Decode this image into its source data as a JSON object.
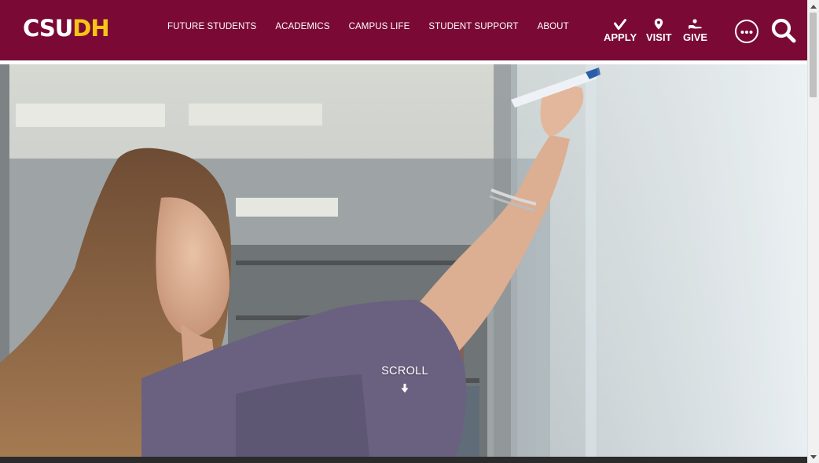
{
  "header": {
    "logo": {
      "csu": "CSU",
      "dh": "DH"
    },
    "nav": [
      {
        "label": "FUTURE STUDENTS"
      },
      {
        "label": "ACADEMICS"
      },
      {
        "label": "CAMPUS LIFE"
      },
      {
        "label": "STUDENT SUPPORT"
      },
      {
        "label": "ABOUT"
      }
    ],
    "actions": [
      {
        "label": "APPLY",
        "icon": "checkmark-icon"
      },
      {
        "label": "VISIT",
        "icon": "map-pin-icon"
      },
      {
        "label": "GIVE",
        "icon": "giving-hand-icon"
      }
    ],
    "more_icon": "more-dots-icon",
    "search_icon": "search-icon"
  },
  "hero": {
    "scroll_label": "SCROLL",
    "scroll_icon": "arrow-down-icon"
  },
  "colors": {
    "brand": "#7a0a35",
    "accent": "#f5c518"
  }
}
